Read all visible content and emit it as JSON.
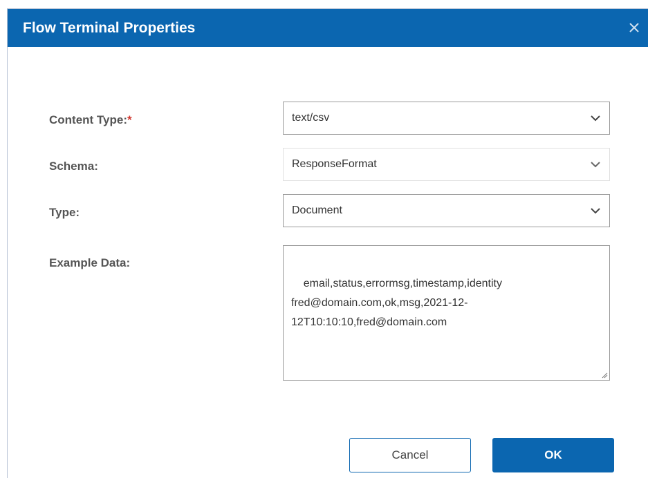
{
  "dialog": {
    "title": "Flow Terminal Properties",
    "close_icon": "close-icon"
  },
  "form": {
    "content_type": {
      "label": "Content Type:",
      "required_mark": "*",
      "value": "text/csv"
    },
    "schema": {
      "label": "Schema:",
      "value": "ResponseFormat"
    },
    "type": {
      "label": "Type:",
      "value": "Document"
    },
    "example_data": {
      "label": "Example Data:",
      "value": "email,status,errormsg,timestamp,identity\nfred@domain.com,ok,msg,2021-12-\n12T10:10:10,fred@domain.com"
    }
  },
  "buttons": {
    "cancel_label": "Cancel",
    "ok_label": "OK"
  },
  "colors": {
    "brand": "#0b66b0",
    "required": "#d0342c"
  }
}
